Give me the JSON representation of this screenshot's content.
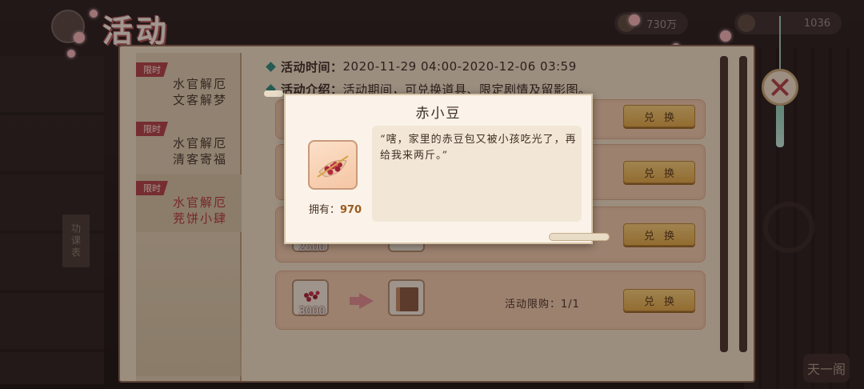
{
  "header": {
    "title": "活动",
    "currency": [
      {
        "value": "730万"
      },
      {
        "value": "1036"
      }
    ]
  },
  "background": {
    "label": "功课表",
    "footer": "天一阁"
  },
  "sidebar": {
    "tabs": [
      {
        "badge": "限时",
        "line1": "水官解厄",
        "line2": "文客解梦",
        "active": false
      },
      {
        "badge": "限时",
        "line1": "水官解厄",
        "line2": "清客寄福",
        "active": false
      },
      {
        "badge": "限时",
        "line1": "水官解厄",
        "line2": "茺饼小肆",
        "active": true
      }
    ]
  },
  "event": {
    "time_label": "活动时间：",
    "time_value": "2020-11-29 04:00-2020-12-06 03:59",
    "intro_label": "活动介绍：",
    "intro_value": "活动期间，可兑换道具、限定剧情及留影图。"
  },
  "exchange": {
    "button_label": "兑换",
    "rows": [
      {
        "cost": "",
        "limit": ""
      },
      {
        "cost": "",
        "limit": ""
      },
      {
        "cost": "2500",
        "limit": ""
      },
      {
        "cost": "3000",
        "limit": "活动限购：1/1"
      }
    ]
  },
  "popup": {
    "title": "赤小豆",
    "description": "“嗐，家里的赤豆包又被小孩吃光了，再给我来两斤。”",
    "owned_label": "拥有：",
    "owned_value": "970"
  },
  "colors": {
    "accent": "#b2434a",
    "panel": "#efdfc7",
    "row": "#ecc6a8",
    "button": "#e0a94a",
    "teal": "#2f8d80"
  }
}
